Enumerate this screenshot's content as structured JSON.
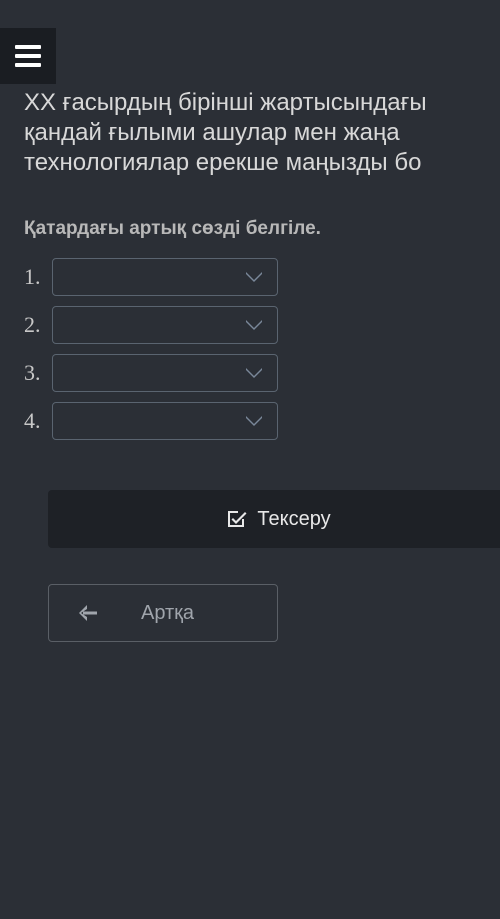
{
  "question": {
    "line1": "ХХ ғасырдың бірінші жартысындағы",
    "line2": "қандай ғылыми ашулар мен жаңа",
    "line3": "технологиялар ерекше маңызды бо"
  },
  "instruction": "Қатардағы артық сөзді белгіле.",
  "dropdowns": [
    {
      "number": "1."
    },
    {
      "number": "2."
    },
    {
      "number": "3."
    },
    {
      "number": "4."
    }
  ],
  "buttons": {
    "check": "Тексеру",
    "back": "Артқа"
  }
}
